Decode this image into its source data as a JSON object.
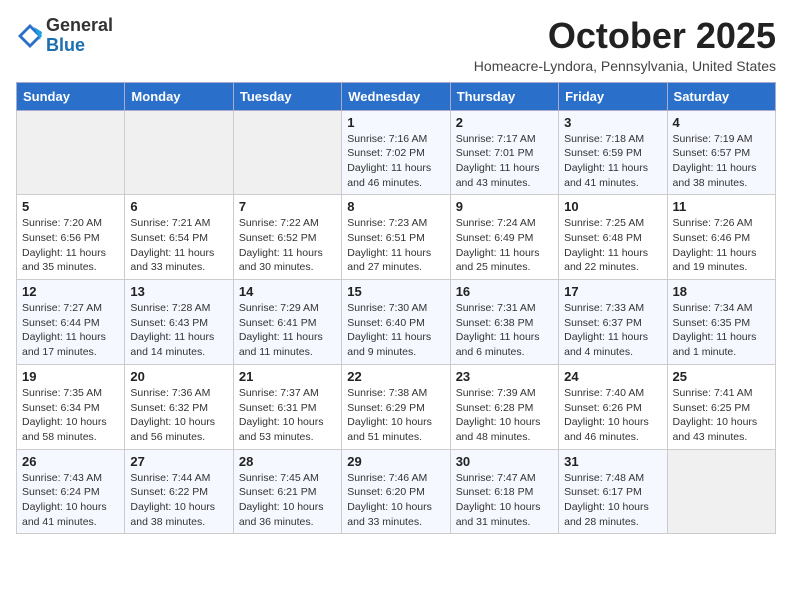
{
  "header": {
    "logo_general": "General",
    "logo_blue": "Blue",
    "month_title": "October 2025",
    "location": "Homeacre-Lyndora, Pennsylvania, United States"
  },
  "days_of_week": [
    "Sunday",
    "Monday",
    "Tuesday",
    "Wednesday",
    "Thursday",
    "Friday",
    "Saturday"
  ],
  "weeks": [
    [
      {
        "day": "",
        "info": ""
      },
      {
        "day": "",
        "info": ""
      },
      {
        "day": "",
        "info": ""
      },
      {
        "day": "1",
        "info": "Sunrise: 7:16 AM\nSunset: 7:02 PM\nDaylight: 11 hours and 46 minutes."
      },
      {
        "day": "2",
        "info": "Sunrise: 7:17 AM\nSunset: 7:01 PM\nDaylight: 11 hours and 43 minutes."
      },
      {
        "day": "3",
        "info": "Sunrise: 7:18 AM\nSunset: 6:59 PM\nDaylight: 11 hours and 41 minutes."
      },
      {
        "day": "4",
        "info": "Sunrise: 7:19 AM\nSunset: 6:57 PM\nDaylight: 11 hours and 38 minutes."
      }
    ],
    [
      {
        "day": "5",
        "info": "Sunrise: 7:20 AM\nSunset: 6:56 PM\nDaylight: 11 hours and 35 minutes."
      },
      {
        "day": "6",
        "info": "Sunrise: 7:21 AM\nSunset: 6:54 PM\nDaylight: 11 hours and 33 minutes."
      },
      {
        "day": "7",
        "info": "Sunrise: 7:22 AM\nSunset: 6:52 PM\nDaylight: 11 hours and 30 minutes."
      },
      {
        "day": "8",
        "info": "Sunrise: 7:23 AM\nSunset: 6:51 PM\nDaylight: 11 hours and 27 minutes."
      },
      {
        "day": "9",
        "info": "Sunrise: 7:24 AM\nSunset: 6:49 PM\nDaylight: 11 hours and 25 minutes."
      },
      {
        "day": "10",
        "info": "Sunrise: 7:25 AM\nSunset: 6:48 PM\nDaylight: 11 hours and 22 minutes."
      },
      {
        "day": "11",
        "info": "Sunrise: 7:26 AM\nSunset: 6:46 PM\nDaylight: 11 hours and 19 minutes."
      }
    ],
    [
      {
        "day": "12",
        "info": "Sunrise: 7:27 AM\nSunset: 6:44 PM\nDaylight: 11 hours and 17 minutes."
      },
      {
        "day": "13",
        "info": "Sunrise: 7:28 AM\nSunset: 6:43 PM\nDaylight: 11 hours and 14 minutes."
      },
      {
        "day": "14",
        "info": "Sunrise: 7:29 AM\nSunset: 6:41 PM\nDaylight: 11 hours and 11 minutes."
      },
      {
        "day": "15",
        "info": "Sunrise: 7:30 AM\nSunset: 6:40 PM\nDaylight: 11 hours and 9 minutes."
      },
      {
        "day": "16",
        "info": "Sunrise: 7:31 AM\nSunset: 6:38 PM\nDaylight: 11 hours and 6 minutes."
      },
      {
        "day": "17",
        "info": "Sunrise: 7:33 AM\nSunset: 6:37 PM\nDaylight: 11 hours and 4 minutes."
      },
      {
        "day": "18",
        "info": "Sunrise: 7:34 AM\nSunset: 6:35 PM\nDaylight: 11 hours and 1 minute."
      }
    ],
    [
      {
        "day": "19",
        "info": "Sunrise: 7:35 AM\nSunset: 6:34 PM\nDaylight: 10 hours and 58 minutes."
      },
      {
        "day": "20",
        "info": "Sunrise: 7:36 AM\nSunset: 6:32 PM\nDaylight: 10 hours and 56 minutes."
      },
      {
        "day": "21",
        "info": "Sunrise: 7:37 AM\nSunset: 6:31 PM\nDaylight: 10 hours and 53 minutes."
      },
      {
        "day": "22",
        "info": "Sunrise: 7:38 AM\nSunset: 6:29 PM\nDaylight: 10 hours and 51 minutes."
      },
      {
        "day": "23",
        "info": "Sunrise: 7:39 AM\nSunset: 6:28 PM\nDaylight: 10 hours and 48 minutes."
      },
      {
        "day": "24",
        "info": "Sunrise: 7:40 AM\nSunset: 6:26 PM\nDaylight: 10 hours and 46 minutes."
      },
      {
        "day": "25",
        "info": "Sunrise: 7:41 AM\nSunset: 6:25 PM\nDaylight: 10 hours and 43 minutes."
      }
    ],
    [
      {
        "day": "26",
        "info": "Sunrise: 7:43 AM\nSunset: 6:24 PM\nDaylight: 10 hours and 41 minutes."
      },
      {
        "day": "27",
        "info": "Sunrise: 7:44 AM\nSunset: 6:22 PM\nDaylight: 10 hours and 38 minutes."
      },
      {
        "day": "28",
        "info": "Sunrise: 7:45 AM\nSunset: 6:21 PM\nDaylight: 10 hours and 36 minutes."
      },
      {
        "day": "29",
        "info": "Sunrise: 7:46 AM\nSunset: 6:20 PM\nDaylight: 10 hours and 33 minutes."
      },
      {
        "day": "30",
        "info": "Sunrise: 7:47 AM\nSunset: 6:18 PM\nDaylight: 10 hours and 31 minutes."
      },
      {
        "day": "31",
        "info": "Sunrise: 7:48 AM\nSunset: 6:17 PM\nDaylight: 10 hours and 28 minutes."
      },
      {
        "day": "",
        "info": ""
      }
    ]
  ]
}
